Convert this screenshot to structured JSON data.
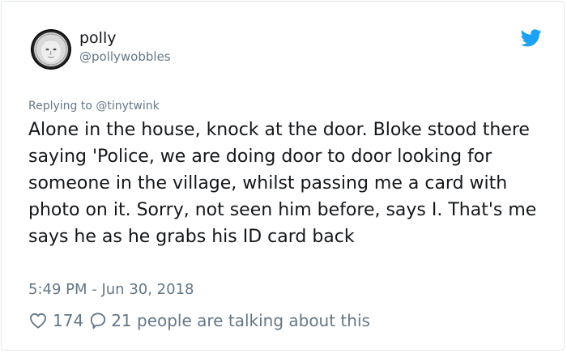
{
  "author": {
    "display_name": "polly",
    "handle": "@pollywobbles"
  },
  "reply": {
    "prefix": "Replying to",
    "to_handle": "@tinytwink"
  },
  "tweet": {
    "text": "Alone in the house, knock at the door. Bloke stood there saying 'Police, we are doing door to door looking for someone in the village, whilst passing me a card with photo on it. Sorry, not seen him before, says I. That's me says he as he grabs his ID card back",
    "timestamp": "5:49 PM - Jun 30, 2018"
  },
  "engagement": {
    "likes": "174",
    "talking": "21 people are talking about this"
  },
  "icons": {
    "brand": "twitter-bird-icon",
    "like": "heart-outline-icon",
    "reply": "speech-bubble-icon"
  },
  "colors": {
    "brand": "#1da1f2",
    "text": "#14171a",
    "secondary": "#657786",
    "border": "#e1e8ed"
  }
}
